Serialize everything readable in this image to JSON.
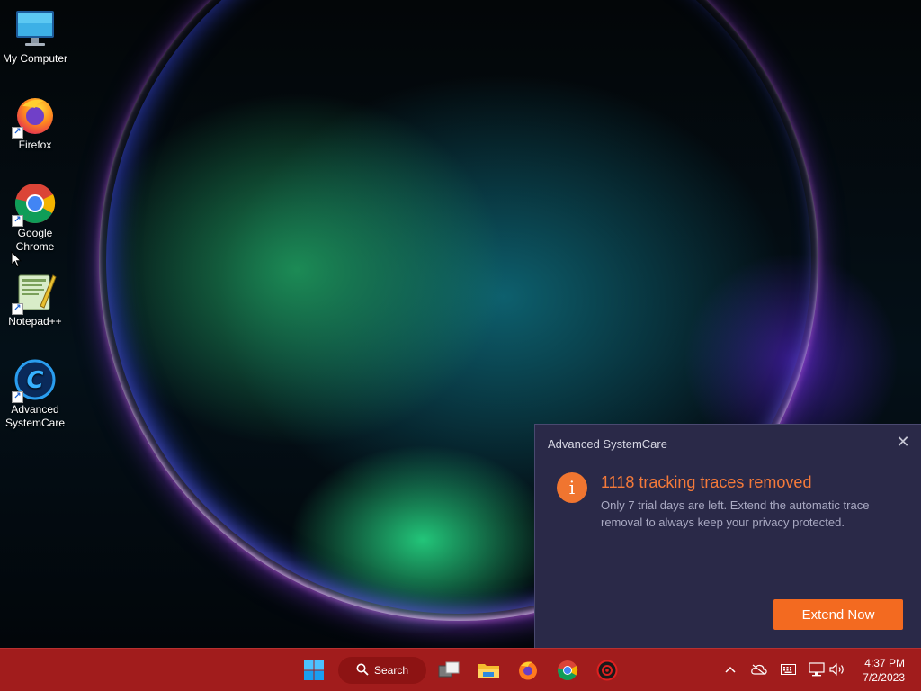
{
  "desktop": {
    "icons": [
      {
        "label": "My Computer"
      },
      {
        "label": "Firefox"
      },
      {
        "label": "Google Chrome"
      },
      {
        "label": "Notepad++"
      },
      {
        "label": "Advanced SystemCare"
      }
    ]
  },
  "notification": {
    "app_name": "Advanced SystemCare",
    "close_glyph": "✕",
    "info_glyph": "i",
    "headline": "1118 tracking traces removed",
    "body": "Only 7 trial days are left. Extend the automatic trace removal to always keep your privacy protected.",
    "button_label": "Extend Now",
    "accent_color": "#f36a20",
    "background_color": "#2a2948"
  },
  "taskbar": {
    "background_color": "#a11c1c",
    "search_label": "Search",
    "pinned": [
      {
        "icon": "windows-start-icon"
      },
      {
        "icon": "search-icon"
      },
      {
        "icon": "task-view-icon"
      },
      {
        "icon": "file-explorer-icon"
      },
      {
        "icon": "firefox-icon"
      },
      {
        "icon": "chrome-icon"
      },
      {
        "icon": "advanced-systemcare-icon"
      }
    ],
    "tray": [
      {
        "icon": "chevron-up-icon"
      },
      {
        "icon": "onedrive-icon"
      },
      {
        "icon": "keyboard-icon"
      },
      {
        "icon": "network-icon"
      },
      {
        "icon": "volume-icon"
      }
    ],
    "clock": {
      "time": "4:37 PM",
      "date": "7/2/2023"
    }
  }
}
